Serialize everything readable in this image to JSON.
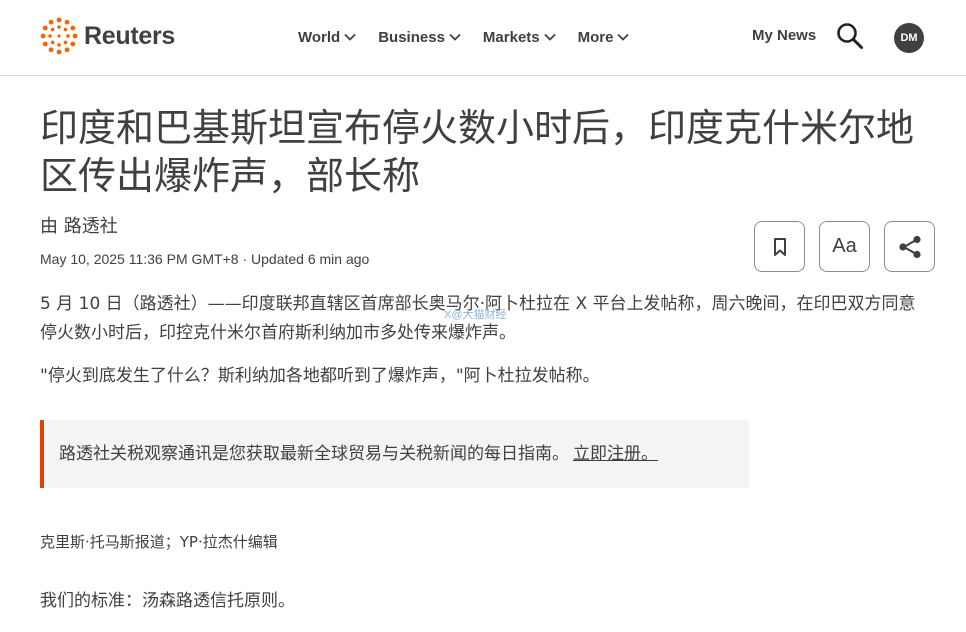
{
  "header": {
    "brand": "Reuters",
    "nav": [
      {
        "label": "World"
      },
      {
        "label": "Business"
      },
      {
        "label": "Markets"
      },
      {
        "label": "More"
      }
    ],
    "my_news": "My News",
    "avatar_initials": "DM",
    "accent": "#fa6400"
  },
  "article": {
    "title": "印度和巴基斯坦宣布停火数小时后，印度克什米尔地区传出爆炸声，部长称",
    "byline": "由 路透社",
    "dateline": "May 10, 2025 11:36 PM GMT+8 · Updated 6 min ago",
    "text_size_label": "Aa",
    "paragraphs": [
      "5 月 10 日（路透社）——印度联邦直辖区首席部长奥马尔·阿卜杜拉在 X 平台上发帖称，周六晚间，在印巴双方同意停火数小时后，印控克什米尔首府斯利纳加市多处传来爆炸声。",
      "\"停火到底发生了什么？斯利纳加各地都听到了爆炸声，\"阿卜杜拉发帖称。"
    ],
    "callout": {
      "text": "路透社关税观察通讯是您获取最新全球贸易与关税新闻的每日指南。",
      "link": "立即注册。",
      "border_color": "#dc4300"
    },
    "watermark": "X@大猫财经",
    "credit": "克里斯·托马斯报道；YP·拉杰什编辑",
    "standards": "我们的标准：汤森路透信托原则。"
  }
}
